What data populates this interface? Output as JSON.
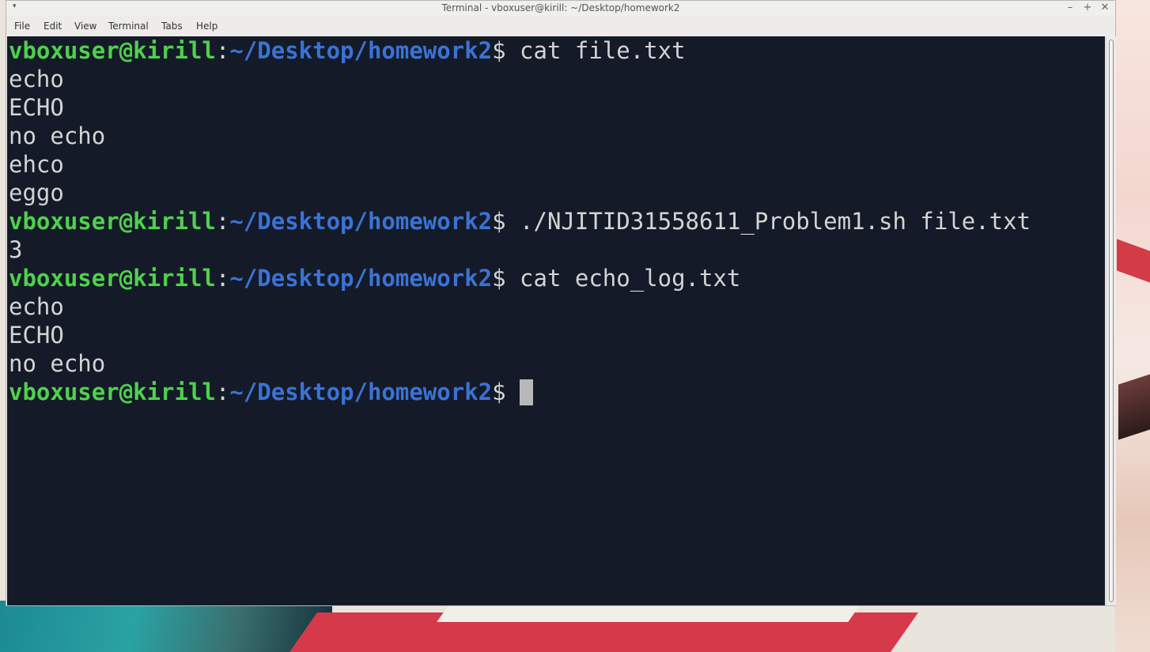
{
  "window": {
    "title": "Terminal - vboxuser@kirill: ~/Desktop/homework2",
    "controls": {
      "minimize": "–",
      "maximize": "+",
      "close": "✕"
    },
    "menu_arrow": "▾"
  },
  "menubar": {
    "items": [
      "File",
      "Edit",
      "View",
      "Terminal",
      "Tabs",
      "Help"
    ]
  },
  "terminal": {
    "prompt": {
      "user": "vboxuser@kirill",
      "colon": ":",
      "path": "~/Desktop/homework2",
      "dollar": "$"
    },
    "lines": [
      {
        "type": "prompt",
        "command": " cat file.txt"
      },
      {
        "type": "output",
        "text": "echo"
      },
      {
        "type": "output",
        "text": "ECHO"
      },
      {
        "type": "output",
        "text": "no echo"
      },
      {
        "type": "output",
        "text": "ehco"
      },
      {
        "type": "output",
        "text": "eggo"
      },
      {
        "type": "prompt",
        "command": " ./NJITID31558611_Problem1.sh file.txt"
      },
      {
        "type": "output",
        "text": "3"
      },
      {
        "type": "prompt",
        "command": " cat echo_log.txt"
      },
      {
        "type": "output",
        "text": "echo"
      },
      {
        "type": "output",
        "text": "ECHO"
      },
      {
        "type": "output",
        "text": "no echo"
      },
      {
        "type": "prompt",
        "command": " "
      }
    ],
    "colors": {
      "background": "#141a27",
      "user": "#4ed14e",
      "path": "#3a73d6",
      "text": "#d4d4d4",
      "cursor": "#b8b8b8"
    }
  }
}
